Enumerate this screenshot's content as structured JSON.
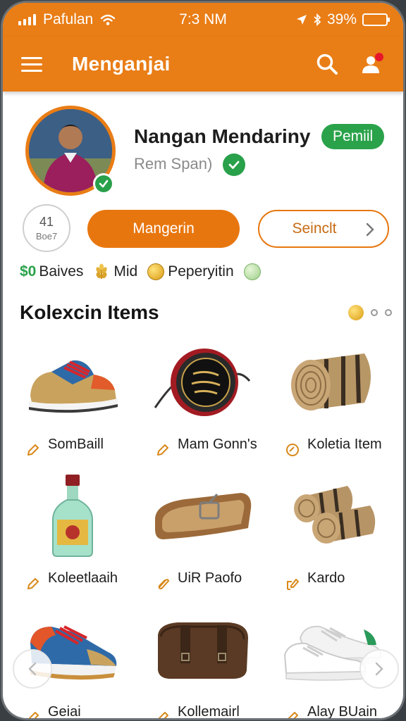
{
  "status_bar": {
    "carrier": "Pafulan",
    "time": "7:3 NM",
    "battery": "39%",
    "battery_level": 0.39
  },
  "app_bar": {
    "title": "Menganjai",
    "icons": [
      "menu-icon",
      "search-icon",
      "user-notification-icon"
    ]
  },
  "profile": {
    "name": "Nangan Mendariny",
    "badge": "Pemiil",
    "subtitle": "Rem Span)",
    "stat_value": "41",
    "stat_label": "Boe7"
  },
  "actions": {
    "primary_label": "Mangerin",
    "secondary_label": "Seinclt"
  },
  "balances": [
    {
      "amount": "$0",
      "label": "Baives",
      "icon": "dollar"
    },
    {
      "amount": "",
      "label": "Mid",
      "icon": "wheat-coin-icon"
    },
    {
      "amount": "",
      "label": "Peperyitin",
      "icon": "gold-coin-icon"
    },
    {
      "amount": "",
      "label": "",
      "icon": "leaf-coin-icon"
    }
  ],
  "collection": {
    "title": "Kolexcin Items",
    "items": [
      {
        "label": "SomBaill",
        "image": "sneaker-colorful"
      },
      {
        "label": "Mam Gonn's",
        "image": "round-badge-box"
      },
      {
        "label": "Koletia Item",
        "image": "rolled-mat"
      },
      {
        "label": "Koleetlaaih",
        "image": "bottle"
      },
      {
        "label": "UiR Paofo",
        "image": "leather-belt"
      },
      {
        "label": "Kardo",
        "image": "double-roll"
      },
      {
        "label": "Geiai",
        "image": "sneaker-blue"
      },
      {
        "label": "Kollemairl",
        "image": "leather-bag"
      },
      {
        "label": "Alay BUain",
        "image": "white-sneakers"
      }
    ]
  },
  "colors": {
    "accent": "#e97d16",
    "success": "#2aa24a",
    "text": "#1d1d1d"
  }
}
